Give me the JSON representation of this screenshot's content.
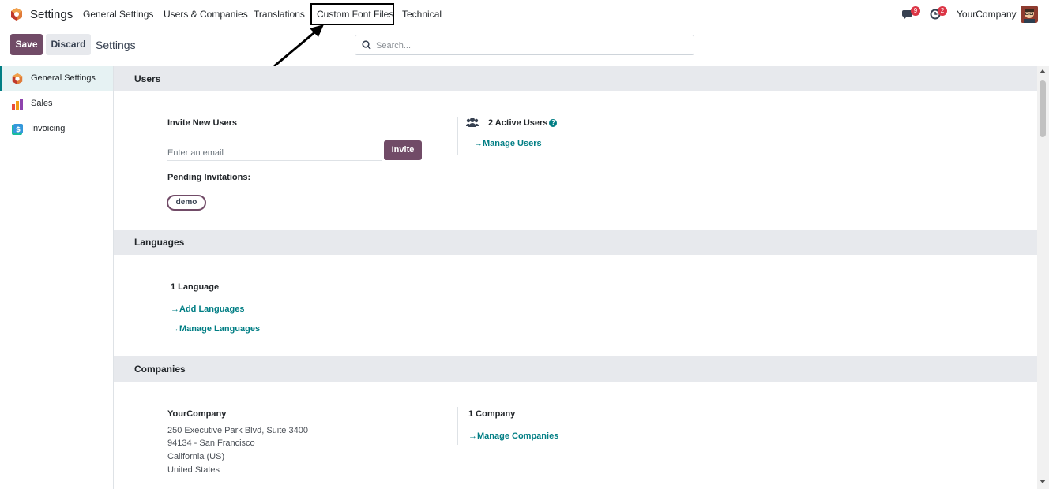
{
  "topbar": {
    "app_name": "Settings",
    "menu": [
      {
        "label": "General Settings"
      },
      {
        "label": "Users & Companies"
      },
      {
        "label": "Translations"
      },
      {
        "label": "Custom Font Files"
      },
      {
        "label": "Technical"
      }
    ],
    "chat_badge": "9",
    "activity_badge": "2",
    "company": "YourCompany"
  },
  "controlbar": {
    "save_label": "Save",
    "discard_label": "Discard",
    "title": "Settings",
    "search_placeholder": "Search..."
  },
  "sidebar": {
    "items": [
      {
        "label": "General Settings",
        "icon": "odoo-settings-icon",
        "active": true
      },
      {
        "label": "Sales",
        "icon": "sales-chart-icon",
        "active": false
      },
      {
        "label": "Invoicing",
        "icon": "invoicing-icon",
        "active": false
      }
    ]
  },
  "users": {
    "title": "Users",
    "invite_label": "Invite New Users",
    "email_placeholder": "Enter an email",
    "invite_button": "Invite",
    "pending_label": "Pending Invitations:",
    "pending_tag": "demo",
    "active_users": "2 Active Users",
    "manage_users": "Manage Users"
  },
  "languages": {
    "title": "Languages",
    "count": "1 Language",
    "add": "Add Languages",
    "manage": "Manage Languages"
  },
  "companies": {
    "title": "Companies",
    "company_name": "YourCompany",
    "address_line1": "250 Executive Park Blvd, Suite 3400",
    "address_line2": "94134 - San Francisco",
    "address_line3": "California (US)",
    "address_line4": "United States",
    "count": "1 Company",
    "manage": "Manage Companies"
  },
  "colors": {
    "brand": "#714b67",
    "link": "#017e84",
    "badge": "#dc3545",
    "section_bg": "#e7e9ed"
  }
}
